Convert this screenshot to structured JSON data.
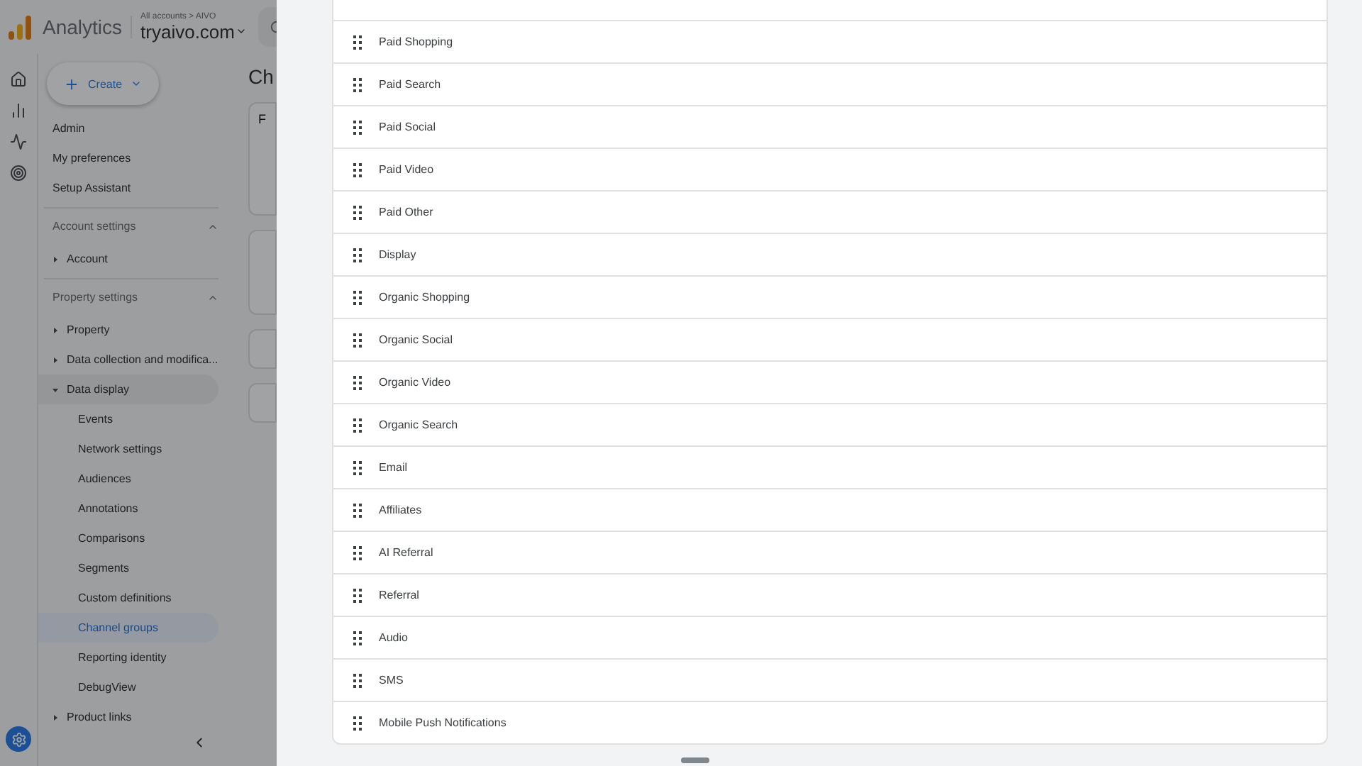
{
  "header": {
    "product": "Analytics",
    "breadcrumb": "All accounts > AIVO",
    "account": "tryaivo.com"
  },
  "create_button": "Create",
  "sidebar": {
    "top_items": [
      {
        "label": "Admin",
        "selected": false
      },
      {
        "label": "My preferences",
        "selected": false
      },
      {
        "label": "Setup Assistant",
        "selected": false
      }
    ],
    "sections": [
      {
        "title": "Account settings",
        "expanded": true,
        "items": [
          {
            "label": "Account",
            "expanded": false
          }
        ]
      },
      {
        "title": "Property settings",
        "expanded": true,
        "items": [
          {
            "label": "Property",
            "expanded": false
          },
          {
            "label": "Data collection and modifica...",
            "expanded": false
          },
          {
            "label": "Data display",
            "expanded": true,
            "children": [
              {
                "label": "Events",
                "selected": false
              },
              {
                "label": "Network settings",
                "selected": false
              },
              {
                "label": "Audiences",
                "selected": false
              },
              {
                "label": "Annotations",
                "selected": false
              },
              {
                "label": "Comparisons",
                "selected": false
              },
              {
                "label": "Segments",
                "selected": false
              },
              {
                "label": "Custom definitions",
                "selected": false
              },
              {
                "label": "Channel groups",
                "selected": true
              },
              {
                "label": "Reporting identity",
                "selected": false
              },
              {
                "label": "DebugView",
                "selected": false
              }
            ]
          },
          {
            "label": "Product links",
            "expanded": false
          }
        ]
      }
    ]
  },
  "main": {
    "title": "Ch",
    "card_label": "F"
  },
  "drawer": {
    "rows": [
      {
        "label": "Paid Shopping"
      },
      {
        "label": "Paid Search"
      },
      {
        "label": "Paid Social"
      },
      {
        "label": "Paid Video"
      },
      {
        "label": "Paid Other"
      },
      {
        "label": "Display"
      },
      {
        "label": "Organic Shopping"
      },
      {
        "label": "Organic Social"
      },
      {
        "label": "Organic Video"
      },
      {
        "label": "Organic Search"
      },
      {
        "label": "Email"
      },
      {
        "label": "Affiliates"
      },
      {
        "label": "AI Referral"
      },
      {
        "label": "Referral"
      },
      {
        "label": "Audio"
      },
      {
        "label": "SMS"
      },
      {
        "label": "Mobile Push Notifications"
      }
    ]
  }
}
